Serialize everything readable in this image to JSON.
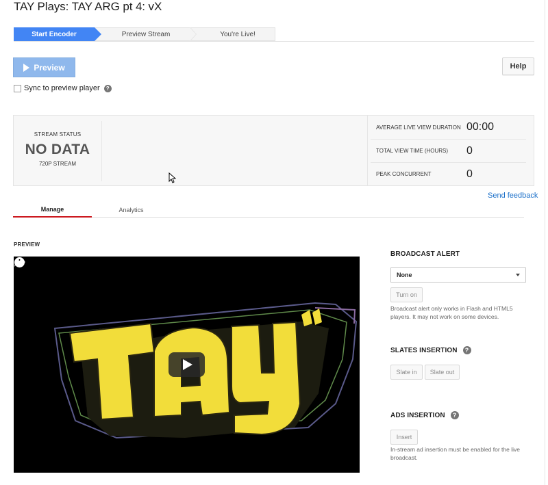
{
  "page": {
    "title": "TAY Plays: TAY ARG pt 4: vX"
  },
  "stepper": {
    "steps": [
      {
        "label": "Start Encoder"
      },
      {
        "label": "Preview Stream"
      },
      {
        "label": "You're Live!"
      }
    ],
    "active_color": "#4285f4"
  },
  "toolbar": {
    "preview_label": "Preview",
    "help_label": "Help",
    "sync_label": "Sync to preview player",
    "sync_checked": false
  },
  "stats": {
    "stream_status_label": "STREAM STATUS",
    "stream_status_value": "NO DATA",
    "stream_quality": "720P STREAM",
    "metrics": [
      {
        "label": "AVERAGE LIVE VIEW DURATION",
        "value": "00:00"
      },
      {
        "label": "TOTAL VIEW TIME (HOURS)",
        "value": "0"
      },
      {
        "label": "PEAK CONCURRENT",
        "value": "0"
      }
    ]
  },
  "feedback": {
    "label": "Send feedback"
  },
  "tabs": [
    {
      "label": "Manage",
      "active": true
    },
    {
      "label": "Analytics",
      "active": false
    }
  ],
  "preview": {
    "section_label": "PREVIEW",
    "icons": [
      "watch-later-icon",
      "share-icon",
      "play-icon"
    ]
  },
  "broadcast_alert": {
    "heading": "BROADCAST ALERT",
    "selected": "None",
    "turn_on_label": "Turn on",
    "note": "Broadcast alert only works in Flash and HTML5 players. It may not work on some devices."
  },
  "slates": {
    "heading": "SLATES INSERTION",
    "slate_in_label": "Slate in",
    "slate_out_label": "Slate out"
  },
  "ads": {
    "heading": "ADS INSERTION",
    "insert_label": "Insert",
    "note": "In-stream ad insertion must be enabled for the live broadcast."
  },
  "colors": {
    "accent_blue": "#4285f4",
    "tab_underline": "#cc181e",
    "link": "#1a6fc9",
    "logo_yellow": "#f2dd3a"
  }
}
